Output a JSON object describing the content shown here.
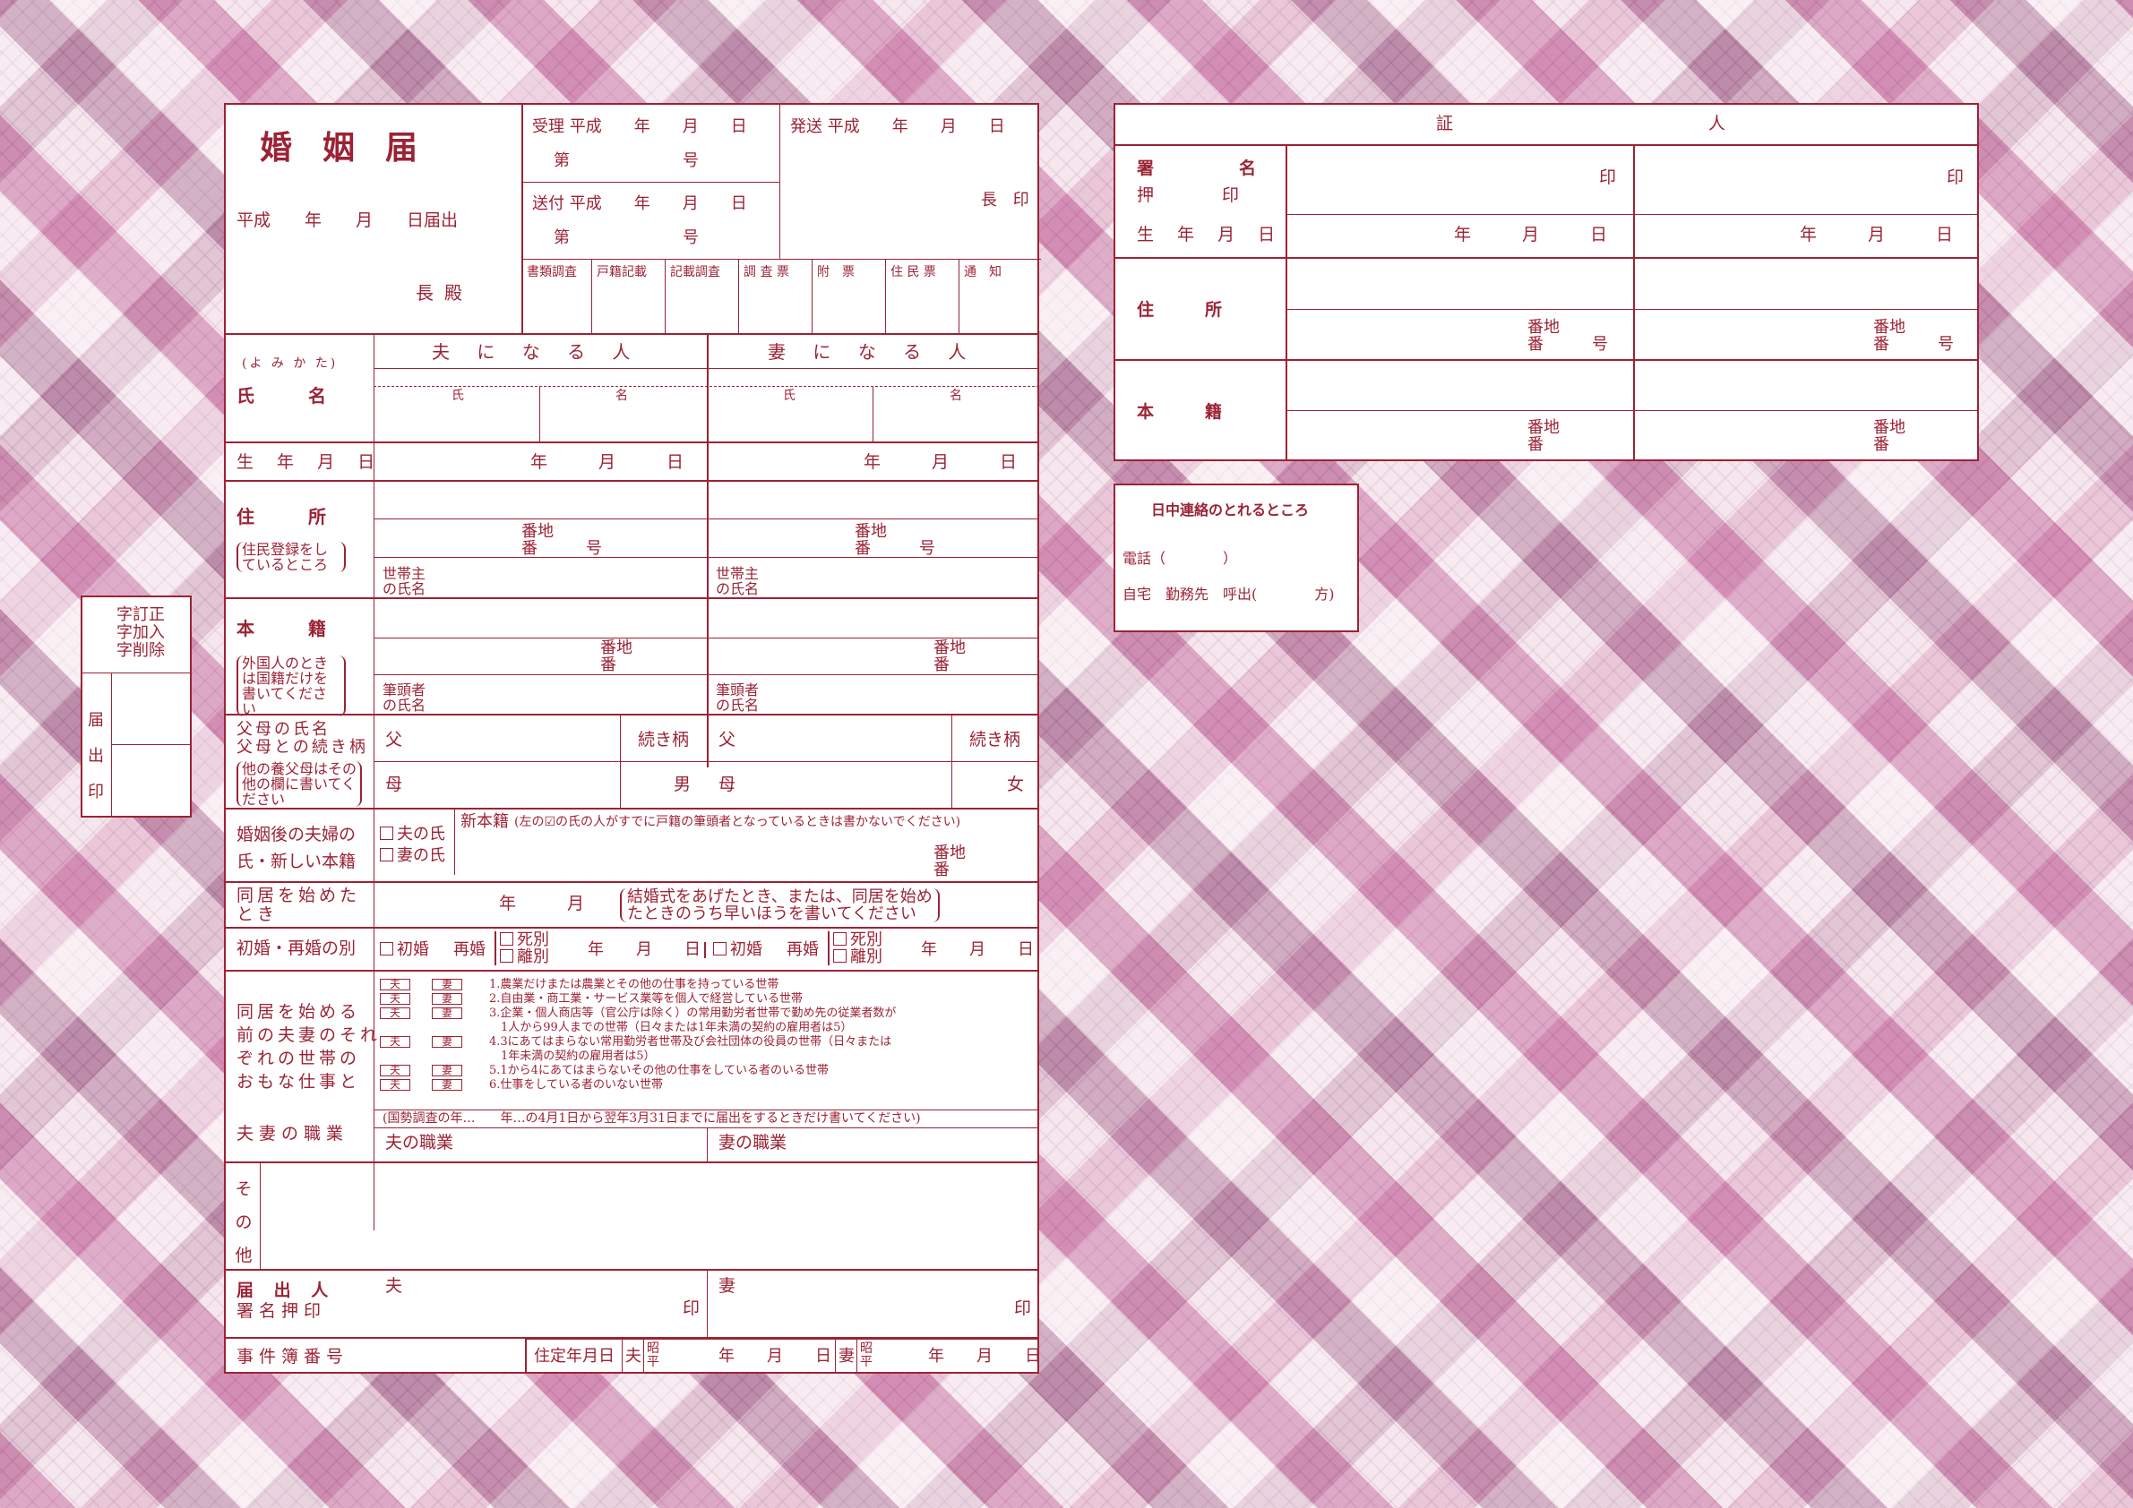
{
  "header": {
    "title": "婚姻届",
    "date_line": "平成　　年　　月　　日届出",
    "addressee": "長殿",
    "received": "受理 平成　　年　　月　　日",
    "received_no": "第　　　　　　　号",
    "sent_to": "送付 平成　　年　　月　　日",
    "sent_no": "第　　　　　　　号",
    "sent_out": "発送 平成　　年　　月　　日",
    "chief": "長 印",
    "checks": [
      "書類調査",
      "戸籍記載",
      "記載調査",
      "調 査 票",
      "附　票",
      "住 民 票",
      "通　知"
    ]
  },
  "columns": {
    "yomi": "(よ み か た)",
    "husband": "夫 に な る 人",
    "wife": "妻 に な る 人"
  },
  "rows": {
    "name": "氏　　　名",
    "surname": "氏",
    "given": "名",
    "birth": "生 年 月 日",
    "ymd": "年　　　月　　　日",
    "address": "住　　　所",
    "address_note": "住民登録をしているところ",
    "banchi": "番地",
    "ban_go": "番　　　号",
    "head": "世帯主",
    "head2": "の氏名",
    "honseki": "本　　　籍",
    "honseki_note": "外国人のときは国籍だけを書いてください",
    "ban": "番",
    "hitto": "筆頭者",
    "hitto2": "の氏名",
    "parents": "父母の氏名",
    "parents2": "父母との続き柄",
    "parents_note": "他の養父母はその他の欄に書いてください",
    "father": "父",
    "mother": "母",
    "relation": "続き柄",
    "male": "男",
    "female": "女",
    "new_name": "婚姻後の夫婦の",
    "new_name2": "氏・新しい本籍",
    "opt_husband": "夫の氏",
    "opt_wife": "妻の氏",
    "new_honseki": "新本籍",
    "new_honseki_note": "(左の☑の氏の人がすでに戸籍の筆頭者となっているときは書かないでください)",
    "cohab": "同居を始めた",
    "cohab2": "とき",
    "cohab_ym": "年　　　月",
    "cohab_note1": "結婚式をあげたとき、または、同居を始め",
    "cohab_note2": "たときのうち早いほうを書いてください",
    "marriage_type": "初婚・再婚の別",
    "first": "初婚",
    "re": "再婚",
    "death": "死別",
    "divorce": "離別",
    "occ_label": [
      "同居を始める",
      "前の夫妻のそれ",
      "ぞれの世帯の",
      "おもな仕事と"
    ],
    "occ_label2": "夫妻の職業",
    "tag_h": "夫",
    "tag_w": "妻",
    "occ_items": [
      "1.農業だけまたは農業とその他の仕事を持っている世帯",
      "2.自由業・商工業・サービス業等を個人で経営している世帯",
      "3.企業・個人商店等（官公庁は除く）の常用勤労者世帯で勤め先の従業者数が",
      "　1人から99人までの世帯（日々または1年未満の契約の雇用者は5）",
      "4.3にあてはまらない常用勤労者世帯及び会社団体の役員の世帯（日々または",
      "　1年未満の契約の雇用者は5）",
      "5.1から4にあてはまらないその他の仕事をしている者のいる世帯",
      "6.仕事をしている者のいない世帯"
    ],
    "census_note": "(国勢調査の年…　　年…の4月1日から翌年3月31日までに届出をするときだけ書いてください)",
    "husband_job": "夫の職業",
    "wife_job": "妻の職業",
    "other": "その他",
    "signer": "届 出 人",
    "signer2": "署名押印",
    "husband": "夫",
    "wife": "妻",
    "seal": "印",
    "case_no": "事件簿番号",
    "residence_date": "住定年月日",
    "showa": "昭",
    "heisei": "平",
    "ymd_short": "年　　月　　日"
  },
  "margin_box": {
    "a": "字訂正",
    "b": "字加入",
    "c": "字削除",
    "d": "届",
    "e": "出",
    "f": "印"
  },
  "witness": {
    "title": "証　　　　　　　　　　　　　　　人",
    "sign": "署　　　　　名",
    "seal_label": "押　　　　印",
    "seal": "印",
    "birth": "生 年 月 日",
    "ymd": "年　　　月　　　日",
    "address": "住　　　所",
    "banchi": "番地",
    "ban_go": "番　　　号",
    "honseki": "本　　　籍",
    "ban": "番"
  },
  "contact": {
    "title": "日中連絡のとれるところ",
    "phone": "電話（　　　　）",
    "where": "自宅　勤務先　呼出(　　　　方)"
  }
}
